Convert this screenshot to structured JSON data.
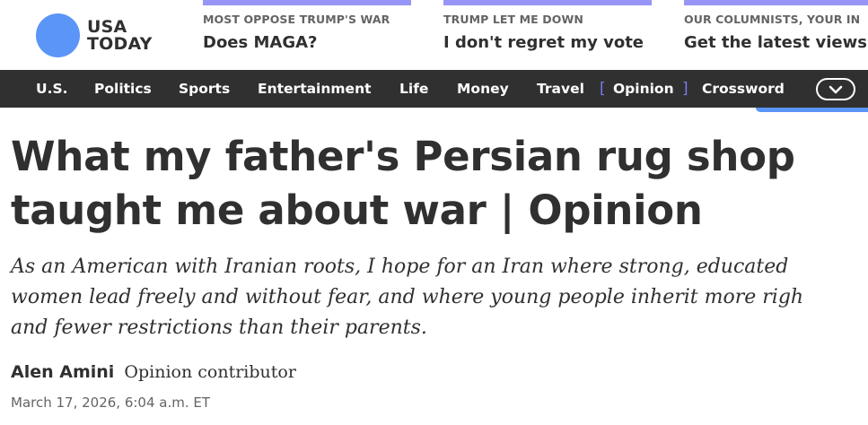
{
  "brand": {
    "line1": "USA",
    "line2": "TODAY",
    "dot_color": "#5b95f8"
  },
  "promos": [
    {
      "kicker": "MOST OPPOSE TRUMP'S WAR",
      "title": "Does MAGA?"
    },
    {
      "kicker": "TRUMP LET ME DOWN",
      "title": "I don't regret my vote"
    },
    {
      "kicker": "OUR COLUMNISTS, YOUR IN",
      "title": "Get the latest views"
    }
  ],
  "nav": {
    "items": [
      "U.S.",
      "Politics",
      "Sports",
      "Entertainment",
      "Life",
      "Money",
      "Travel",
      "Opinion",
      "Crossword"
    ],
    "active": "Opinion",
    "bracket_open": "[",
    "bracket_close": "]",
    "more_icon": "chevron-down-icon"
  },
  "article": {
    "headline": "What my father's Persian rug shop taught me about war | Opinion",
    "dek_lines": [
      "As an American with Iranian roots, I hope for an Iran where strong, educated",
      "women lead freely and without fear, and where young people inherit more righ",
      "and fewer restrictions than their parents."
    ],
    "author": "Alen Amini",
    "role": "Opinion contributor",
    "date": "March 17, 2026, 6:04 a.m. ET"
  },
  "colors": {
    "accent": "#9795f7",
    "nav_bg": "#303030",
    "text": "#303030",
    "muted": "#646464"
  }
}
